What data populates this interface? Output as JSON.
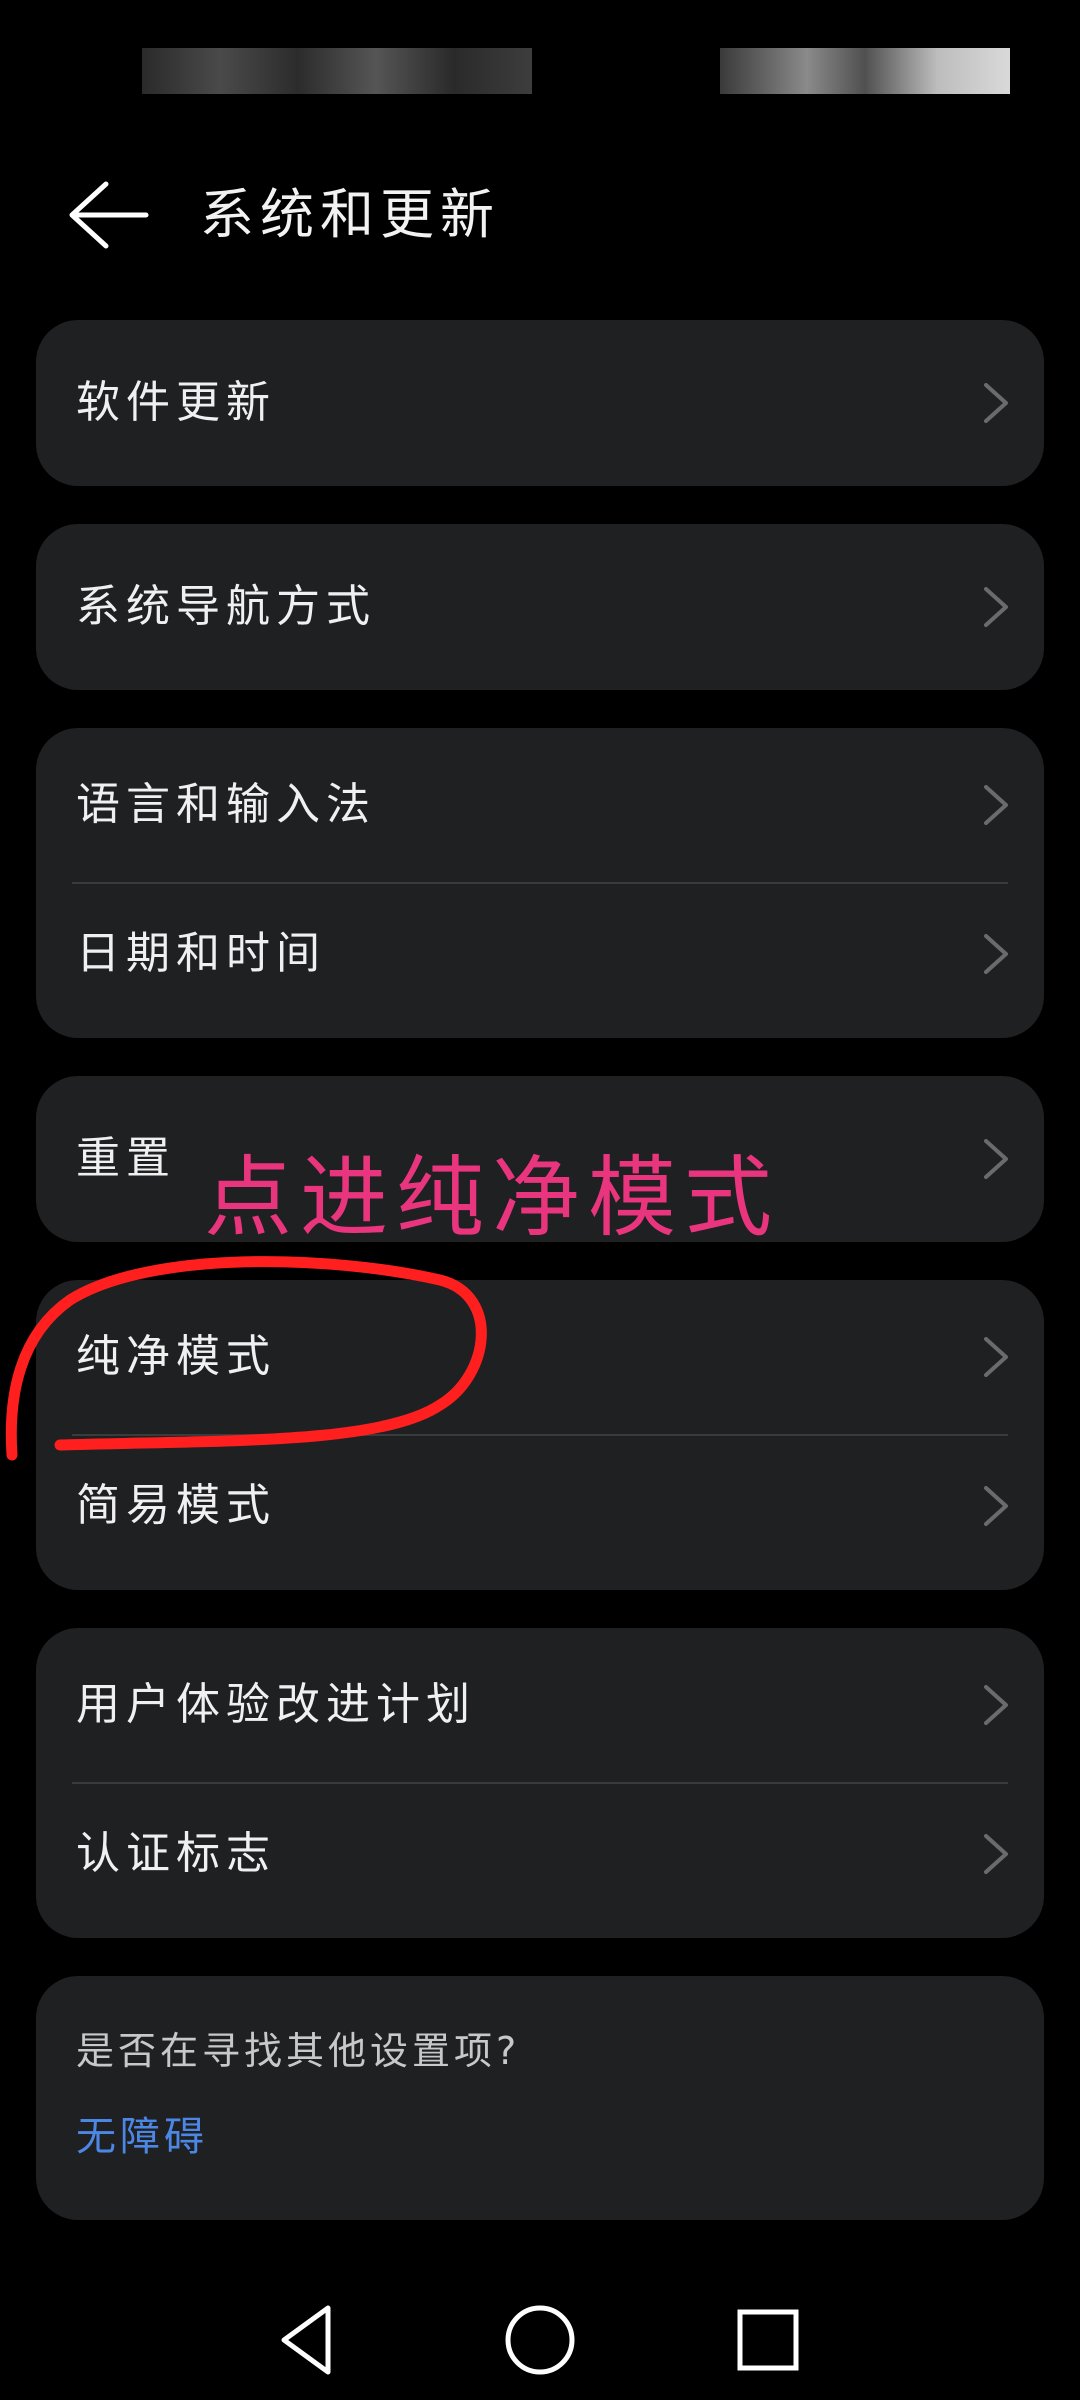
{
  "header": {
    "title": "系统和更新"
  },
  "cards": [
    {
      "items": [
        {
          "label": "软件更新"
        }
      ]
    },
    {
      "items": [
        {
          "label": "系统导航方式"
        }
      ]
    },
    {
      "items": [
        {
          "label": "语言和输入法"
        },
        {
          "label": "日期和时间"
        }
      ]
    },
    {
      "items": [
        {
          "label": "重置"
        }
      ]
    },
    {
      "items": [
        {
          "label": "纯净模式"
        },
        {
          "label": "简易模式"
        }
      ]
    },
    {
      "items": [
        {
          "label": "用户体验改进计划"
        },
        {
          "label": "认证标志"
        }
      ]
    }
  ],
  "footer": {
    "hint": "是否在寻找其他设置项?",
    "link": "无障碍"
  },
  "annotation": {
    "text": "点进纯净模式",
    "color": "#e8357d"
  },
  "colors": {
    "background": "#000000",
    "card": "#1f2022",
    "link": "#4d87e6"
  }
}
